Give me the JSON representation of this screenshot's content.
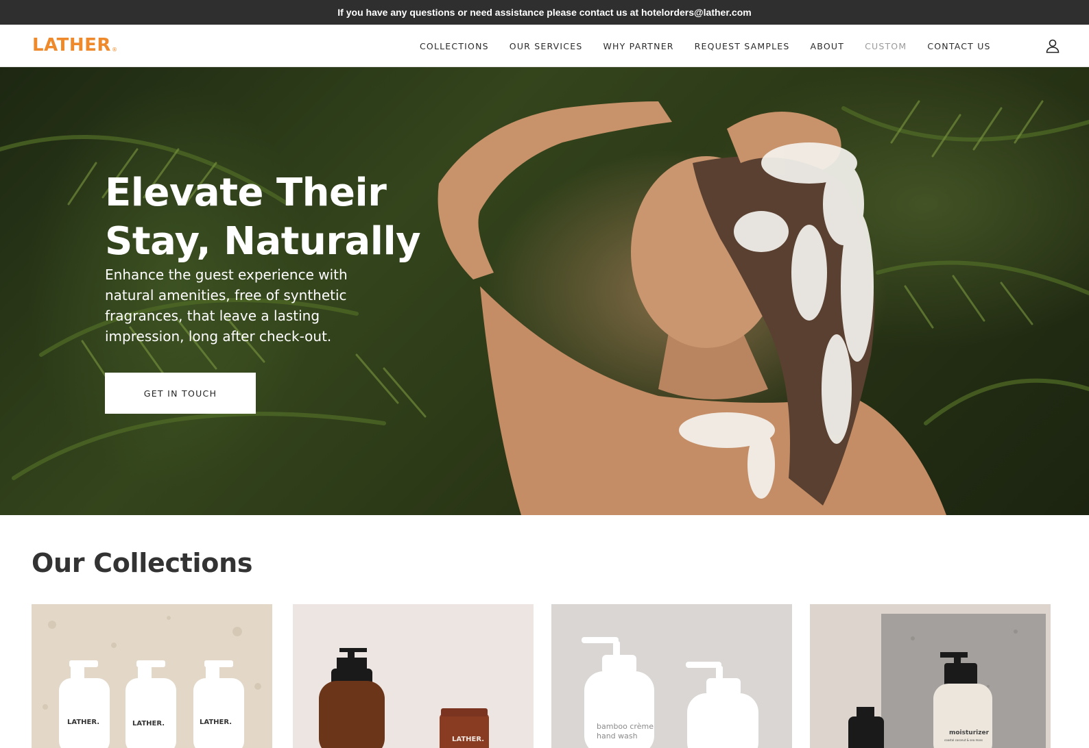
{
  "announcement": {
    "text": "If you have any questions or need assistance please contact us at hotelorders@lather.com"
  },
  "header": {
    "logo": "LATHER",
    "logo_mark": "®",
    "nav": [
      {
        "label": "COLLECTIONS"
      },
      {
        "label": "OUR SERVICES"
      },
      {
        "label": "WHY PARTNER"
      },
      {
        "label": "REQUEST SAMPLES"
      },
      {
        "label": "ABOUT"
      },
      {
        "label": "CUSTOM"
      },
      {
        "label": "CONTACT US"
      }
    ],
    "account_icon": "user-icon"
  },
  "hero": {
    "title_line1": "Elevate Their",
    "title_line2": "Stay, Naturally",
    "subtitle": "Enhance the guest experience with natural amenities, free of synthetic fragrances, that leave a lasting impression, long after check-out.",
    "cta_label": "GET IN TOUCH"
  },
  "collections": {
    "title": "Our Collections",
    "cards": [
      {
        "labels": [
          "LATHER.",
          "LATHER.",
          "LATHER."
        ]
      },
      {
        "labels": [
          "LATHER."
        ]
      },
      {
        "labels": [
          "bamboo crème",
          "hand wash"
        ]
      },
      {
        "labels": [
          "moisturizer",
          "coastal coconut & sea moss"
        ]
      }
    ]
  },
  "colors": {
    "brand": "#ee8a2b",
    "announcement_bg": "#2f2f2f",
    "nav_muted": "#9a9a9a"
  }
}
